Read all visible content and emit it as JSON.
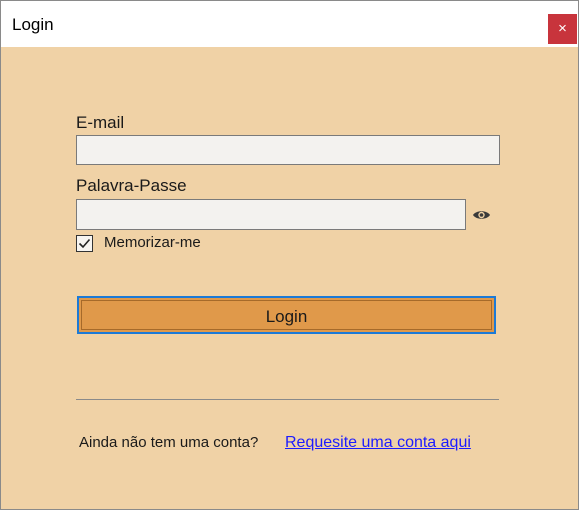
{
  "window": {
    "title": "Login",
    "close_label": "×"
  },
  "form": {
    "email_label": "E-mail",
    "email_value": "",
    "password_label": "Palavra-Passe",
    "password_value": "",
    "remember_label": "Memorizar-me",
    "remember_checked": true,
    "login_button": "Login"
  },
  "footer": {
    "no_account_text": "Ainda não tem uma conta?",
    "request_link": "Requesite uma conta aqui"
  },
  "icons": {
    "close": "close-icon",
    "show_password": "eye-icon",
    "check": "checkmark-icon"
  },
  "colors": {
    "background": "#f0d2a6",
    "button": "#e0994a",
    "focus_border": "#1c7ad6",
    "close_button": "#c8343c",
    "link": "#1c1cff"
  }
}
